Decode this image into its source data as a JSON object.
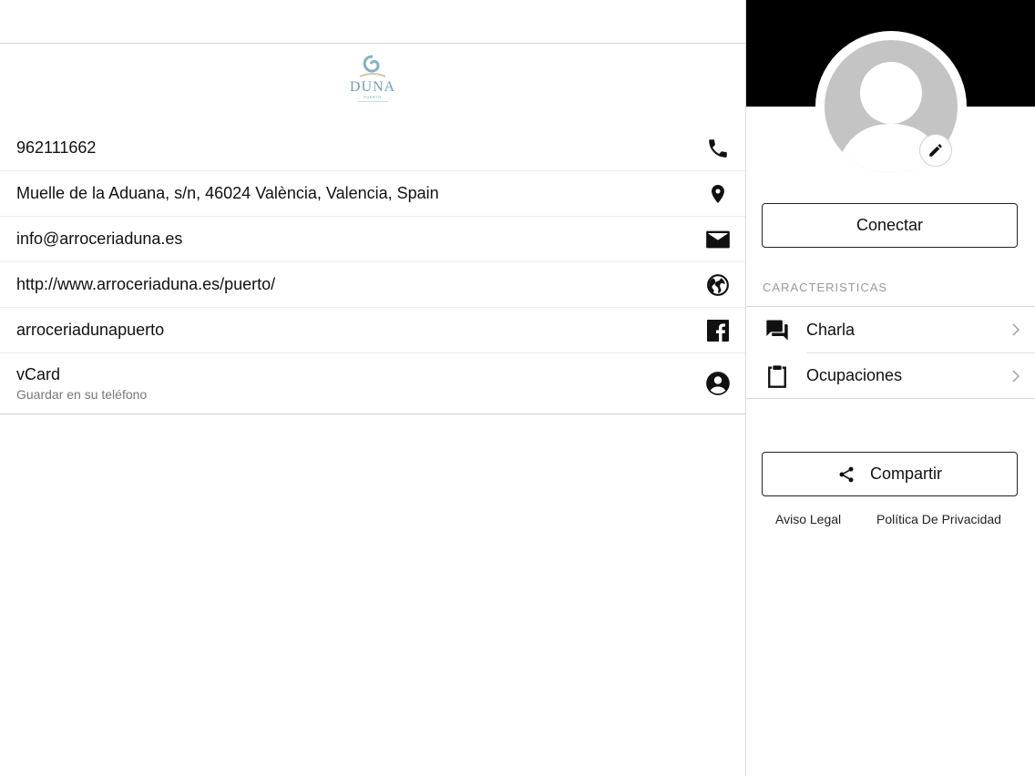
{
  "logo": {
    "wordmark": "DUNA",
    "sub": "PUERTO"
  },
  "contact_rows": [
    {
      "text": "962111662",
      "icon": "phone-icon"
    },
    {
      "text": "Muelle de la Aduana, s/n, 46024 València, Valencia, Spain",
      "icon": "location-pin-icon"
    },
    {
      "text": "info@arroceriaduna.es",
      "icon": "email-icon"
    },
    {
      "text": "http://www.arroceriaduna.es/puerto/",
      "icon": "globe-icon"
    },
    {
      "text": "arroceriadunapuerto",
      "icon": "facebook-icon"
    }
  ],
  "vcard": {
    "title": "vCard",
    "subtitle": "Guardar en su teléfono",
    "icon": "account-circle-icon"
  },
  "profile": {
    "connect_label": "Conectar",
    "section_label": "CARACTERISTICAS",
    "menu": [
      {
        "label": "Charla",
        "icon": "chat-icon"
      },
      {
        "label": "Ocupaciones",
        "icon": "clipboard-icon"
      }
    ],
    "share_label": "Compartir",
    "legal_label": "Aviso Legal",
    "privacy_label": "Política De Privacidad"
  },
  "colors": {
    "cover": "#000000",
    "avatar_placeholder": "#c4c4c4",
    "logo_blue": "#6f9fb0"
  }
}
